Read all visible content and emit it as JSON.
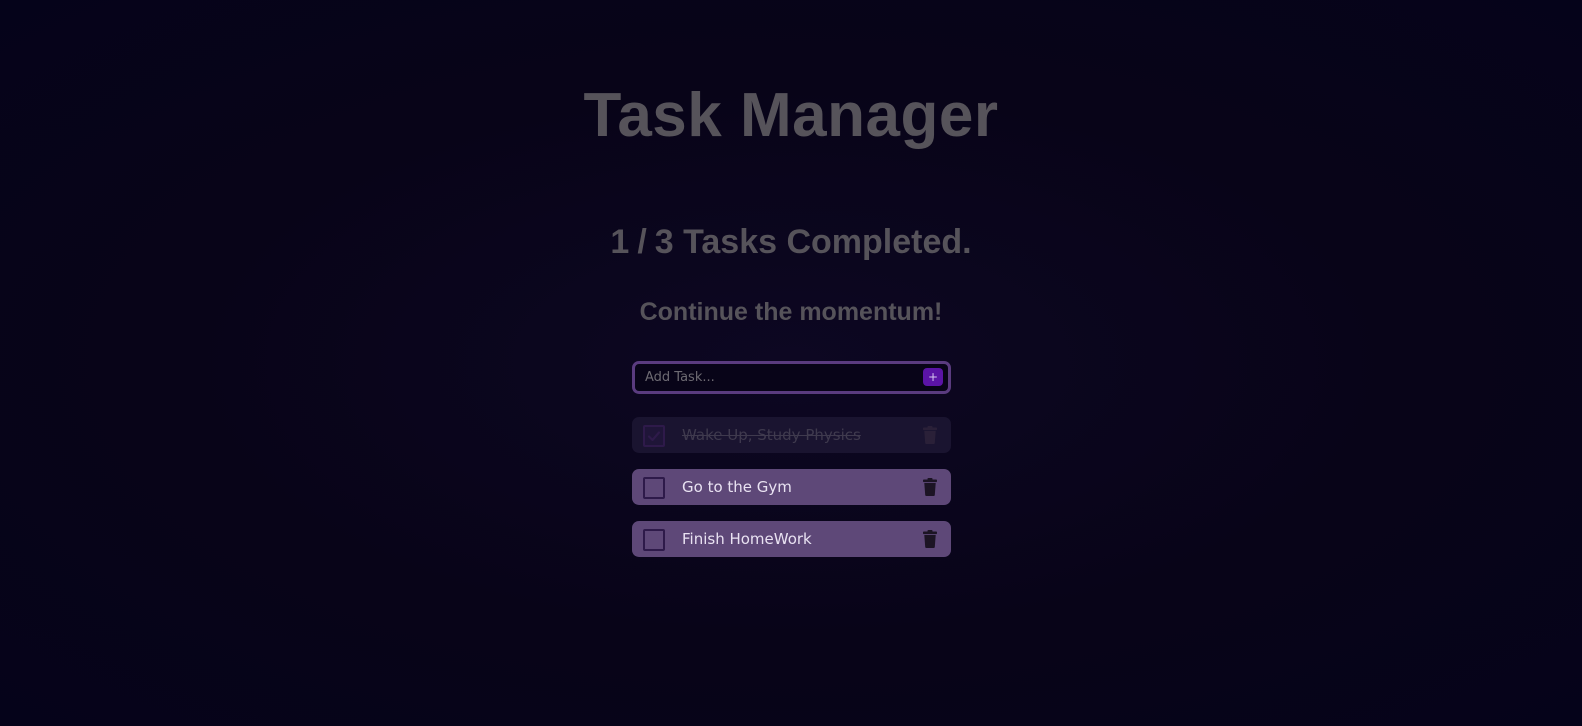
{
  "header": {
    "title": "Task Manager"
  },
  "progress": {
    "completed": "1",
    "separator": "/",
    "total": "3",
    "suffix": "Tasks Completed."
  },
  "motto": "Continue the momentum!",
  "add_form": {
    "placeholder": "Add Task...",
    "value": "",
    "button_label": "+"
  },
  "tasks": [
    {
      "label": "Wake Up, Study Physics",
      "completed": true
    },
    {
      "label": "Go to the Gym",
      "completed": false
    },
    {
      "label": "Finish HomeWork",
      "completed": false
    }
  ],
  "icons": {
    "delete": "trash-icon",
    "check": "checkmark-icon"
  },
  "colors": {
    "background": "#080418",
    "accent": "#5b14a6",
    "task_background": "#5e4878",
    "completed_task_background": "#1a1430",
    "heading_text": "#56535a"
  }
}
